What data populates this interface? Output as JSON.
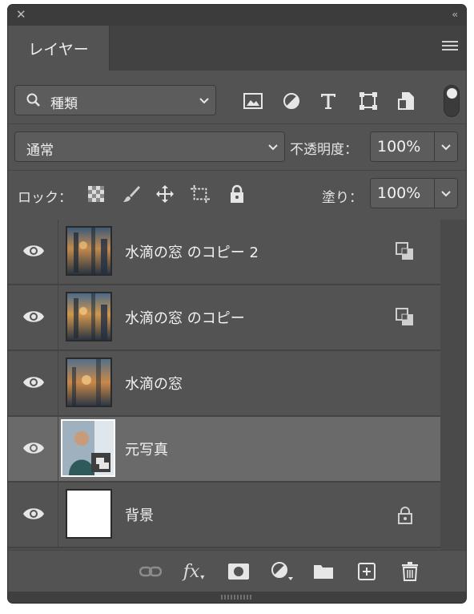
{
  "panel": {
    "tab_label": "レイヤー",
    "filter": {
      "label": "種類"
    },
    "blend_mode": "通常",
    "opacity_label": "不透明度：",
    "opacity_value": "100%",
    "lock_label": "ロック：",
    "fill_label": "塗り：",
    "fill_value": "100%"
  },
  "layers": [
    {
      "name": "水滴の窓 のコピー 2",
      "visible": true,
      "selected": false,
      "thumb": "rain-window",
      "badge": "smart-object-icon"
    },
    {
      "name": "水滴の窓 のコピー",
      "visible": true,
      "selected": false,
      "thumb": "rain-window",
      "badge": "smart-object-icon"
    },
    {
      "name": "水滴の窓",
      "visible": true,
      "selected": false,
      "thumb": "rain-window",
      "badge": ""
    },
    {
      "name": "元写真",
      "visible": true,
      "selected": true,
      "thumb": "person-photo",
      "badge": ""
    },
    {
      "name": "背景",
      "visible": true,
      "selected": false,
      "thumb": "white",
      "badge": "lock-icon"
    }
  ],
  "colors": {
    "panel_bg": "#535353",
    "selected_layer_bg": "#6a6a6a",
    "title_bar": "#3c3c3c"
  }
}
